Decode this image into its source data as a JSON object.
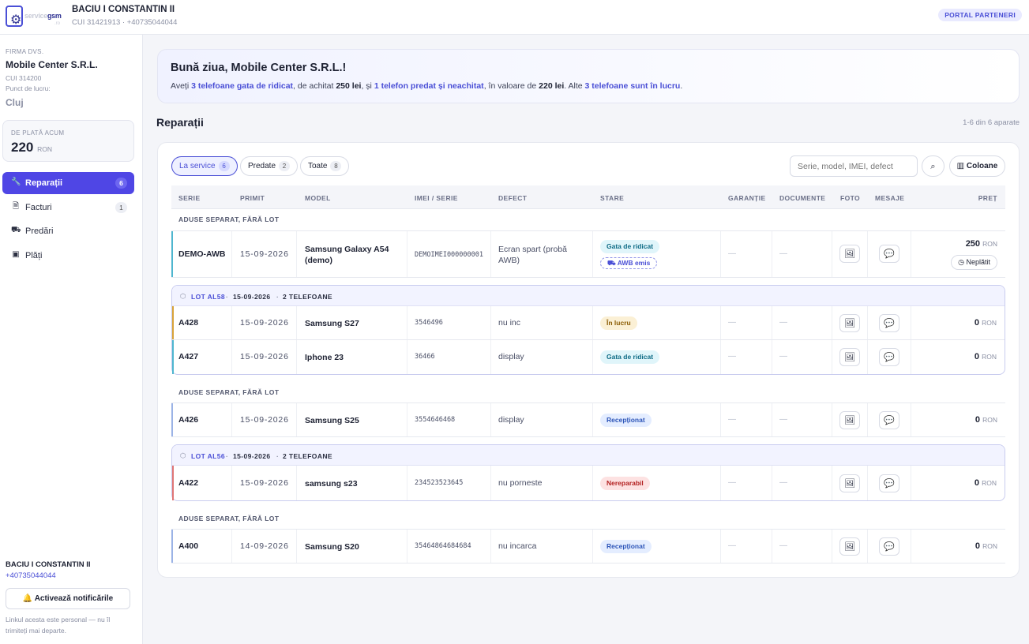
{
  "header": {
    "logo_text_a": "service",
    "logo_text_b": "gsm",
    "logo_text_c": ".ro",
    "name": "BACIU I CONSTANTIN II",
    "sub": "CUI 31421913 · +40735044044",
    "portal_label": "PORTAL PARTENERI"
  },
  "sidebar": {
    "firm_label": "FIRMA DVS.",
    "company": "Mobile Center S.R.L.",
    "cui": "CUI 314200",
    "point_label": "Punct de lucru:",
    "city": "Cluj",
    "pay_label": "DE PLATĂ ACUM",
    "pay_value": "220",
    "pay_currency": "RON",
    "nav": [
      {
        "label": "Reparații",
        "badge": "6",
        "icon": "wrench-icon"
      },
      {
        "label": "Facturi",
        "badge": "1",
        "icon": "invoice-icon"
      },
      {
        "label": "Predări",
        "badge": "",
        "icon": "truck-icon"
      },
      {
        "label": "Plăți",
        "badge": "",
        "icon": "wallet-icon"
      }
    ],
    "user": "BACIU I CONSTANTIN II",
    "phone": "+40735044044",
    "notif_label": "Activează notificările",
    "note": "Linkul acesta este personal — nu îl trimiteți mai departe."
  },
  "welcome": {
    "title": "Bună ziua, Mobile Center S.R.L.!",
    "p1": "Aveți ",
    "h1": "3 telefoane gata de ridicat",
    "p2": ", de achitat ",
    "b1": "250 lei",
    "p3": ", și ",
    "h2": "1 telefon predat și neachitat",
    "p4": ", în valoare de ",
    "b2": "220 lei",
    "p5": ". Alte ",
    "h3": "3 telefoane sunt în lucru",
    "p6": "."
  },
  "repairs": {
    "title": "Reparații",
    "count": "1-6 din 6 aparate",
    "tabs": [
      {
        "label": "La service",
        "count": "6"
      },
      {
        "label": "Predate",
        "count": "2"
      },
      {
        "label": "Toate",
        "count": "8"
      }
    ],
    "search_placeholder": "Serie, model, IMEI, defect",
    "columns_label": "Coloane",
    "headers": [
      "SERIE",
      "PRIMIT",
      "MODEL",
      "IMEI / SERIE",
      "DEFECT",
      "STARE",
      "GARANȚIE",
      "DOCUMENTE",
      "FOTO",
      "MESAJE",
      "PREȚ"
    ],
    "separate_label": "ADUSE SEPARAT, FĂRĂ LOT",
    "lot58": {
      "id": "LOT AL58",
      "date": "15-09-2026",
      "count": "2 TELEFOANE"
    },
    "lot56": {
      "id": "LOT AL56",
      "date": "15-09-2026",
      "count": "2 TELEFOANE"
    },
    "dot": "·",
    "dash": "—",
    "currency": "RON",
    "rows": [
      {
        "serie": "DEMO-AWB",
        "date": "15-09-2026",
        "model": "Samsung Galaxy A54 (demo)",
        "imei": "DEMOIMEI000000001",
        "defect": "Ecran spart (probă AWB)",
        "status": "Gata de ridicat",
        "awb": "AWB emis",
        "price": "250",
        "unpaid": "Neplătit"
      },
      {
        "serie": "A428",
        "date": "15-09-2026",
        "model": "Samsung S27",
        "imei": "3546496",
        "defect": "nu inc",
        "status": "În lucru",
        "price": "0"
      },
      {
        "serie": "A427",
        "date": "15-09-2026",
        "model": "Iphone 23",
        "imei": "36466",
        "defect": "display",
        "status": "Gata de ridicat",
        "price": "0"
      },
      {
        "serie": "A426",
        "date": "15-09-2026",
        "model": "Samsung S25",
        "imei": "3554646468",
        "defect": "display",
        "status": "Recepționat",
        "price": "0"
      },
      {
        "serie": "A422",
        "date": "15-09-2026",
        "model": "samsung s23",
        "imei": "234523523645",
        "defect": "nu porneste",
        "status": "Nereparabil",
        "price": "0"
      },
      {
        "serie": "A400",
        "date": "14-09-2026",
        "model": "Samsung S20",
        "imei": "35464864684684",
        "defect": "nu incarca",
        "status": "Recepționat",
        "price": "0"
      }
    ]
  },
  "colors": {
    "accent": "#4f46e5",
    "ready": "#4fb6cf",
    "in_progress": "#d8a33a",
    "received": "#9bb3e6",
    "unrepairable": "#e07676"
  }
}
